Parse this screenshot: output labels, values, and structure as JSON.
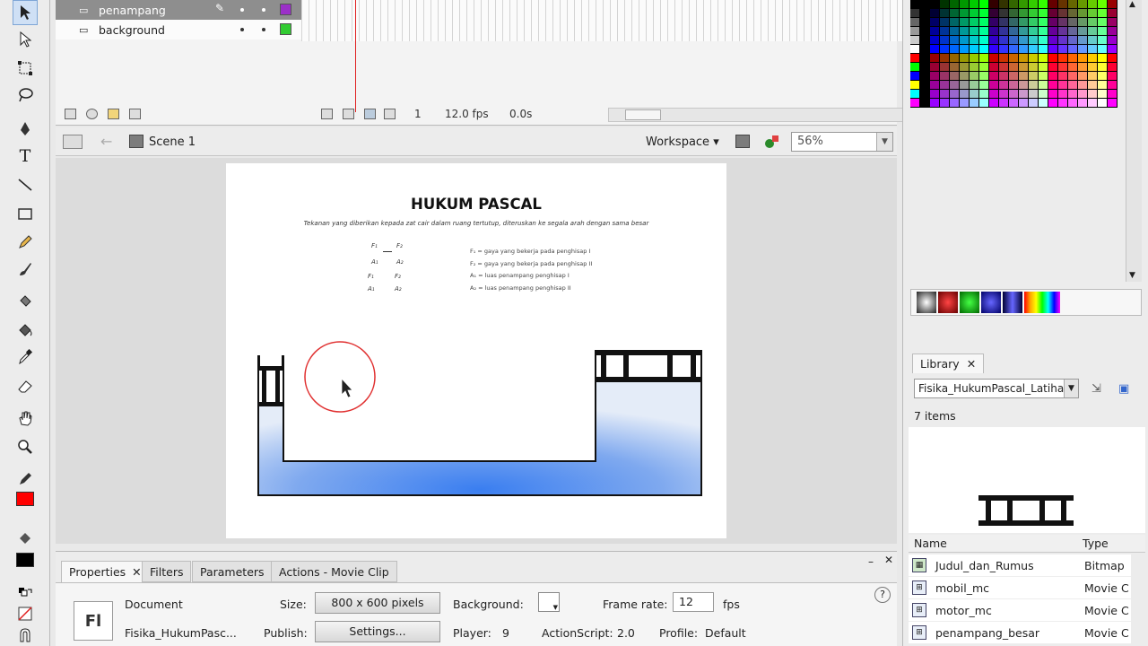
{
  "timeline": {
    "layers": [
      {
        "name": "penampang",
        "color": "#9b30c8"
      },
      {
        "name": "background",
        "color": "#33cc33"
      }
    ],
    "frame": "1",
    "fps": "12.0 fps",
    "time": "0.0s"
  },
  "editbar": {
    "scene": "Scene 1",
    "workspace": "Workspace ▾",
    "zoom": "56%"
  },
  "stage": {
    "title": "HUKUM PASCAL",
    "subtitle": "Tekanan yang diberikan kepada zat cair dalam ruang tertutup, diteruskan ke segala arah dengan sama besar",
    "formula_row1_left": "F₁",
    "formula_row1_right": "F₂",
    "formula_row2_left": "A₁",
    "formula_row2_right": "A₂",
    "formula_row3_left": "F₁",
    "formula_row3_right": "F₂",
    "formula_row4_left": "A₁",
    "formula_row4_right": "A₂",
    "legend": [
      "F₁  = gaya yang bekerja pada penghisap I",
      "F₂  = gaya yang bekerja pada penghisap II",
      "A₁  = luas penampang penghisap I",
      "A₂  = luas penampang penghisap II"
    ]
  },
  "library": {
    "tab": "Library",
    "document": "Fisika_HukumPascal_Latihan",
    "count": "7 items",
    "col_name": "Name",
    "col_type": "Type",
    "items": [
      {
        "name": "Judul_dan_Rumus",
        "type": "Bitmap"
      },
      {
        "name": "mobil_mc",
        "type": "Movie Clip"
      },
      {
        "name": "motor_mc",
        "type": "Movie Clip"
      },
      {
        "name": "penampang_besar",
        "type": "Movie Clip"
      }
    ]
  },
  "properties": {
    "tabs": [
      "Properties",
      "Filters",
      "Parameters",
      "Actions - Movie Clip"
    ],
    "icon": "Fl",
    "doc_label": "Document",
    "doc_name": "Fisika_HukumPasc...",
    "size_label": "Size:",
    "size_value": "800 x 600 pixels",
    "publish_label": "Publish:",
    "publish_value": "Settings...",
    "bg_label": "Background:",
    "player_label": "Player:",
    "player_value": "9",
    "framerate_label": "Frame rate:",
    "framerate_value": "12",
    "fps_label": "fps",
    "as_label": "ActionScript:",
    "as_value": "2.0",
    "profile_label": "Profile:",
    "profile_value": "Default"
  },
  "colors": {
    "fill": "#ff0000",
    "stroke": "#000000",
    "highlight": "#cfe0f5",
    "water": "#4f88e8"
  }
}
